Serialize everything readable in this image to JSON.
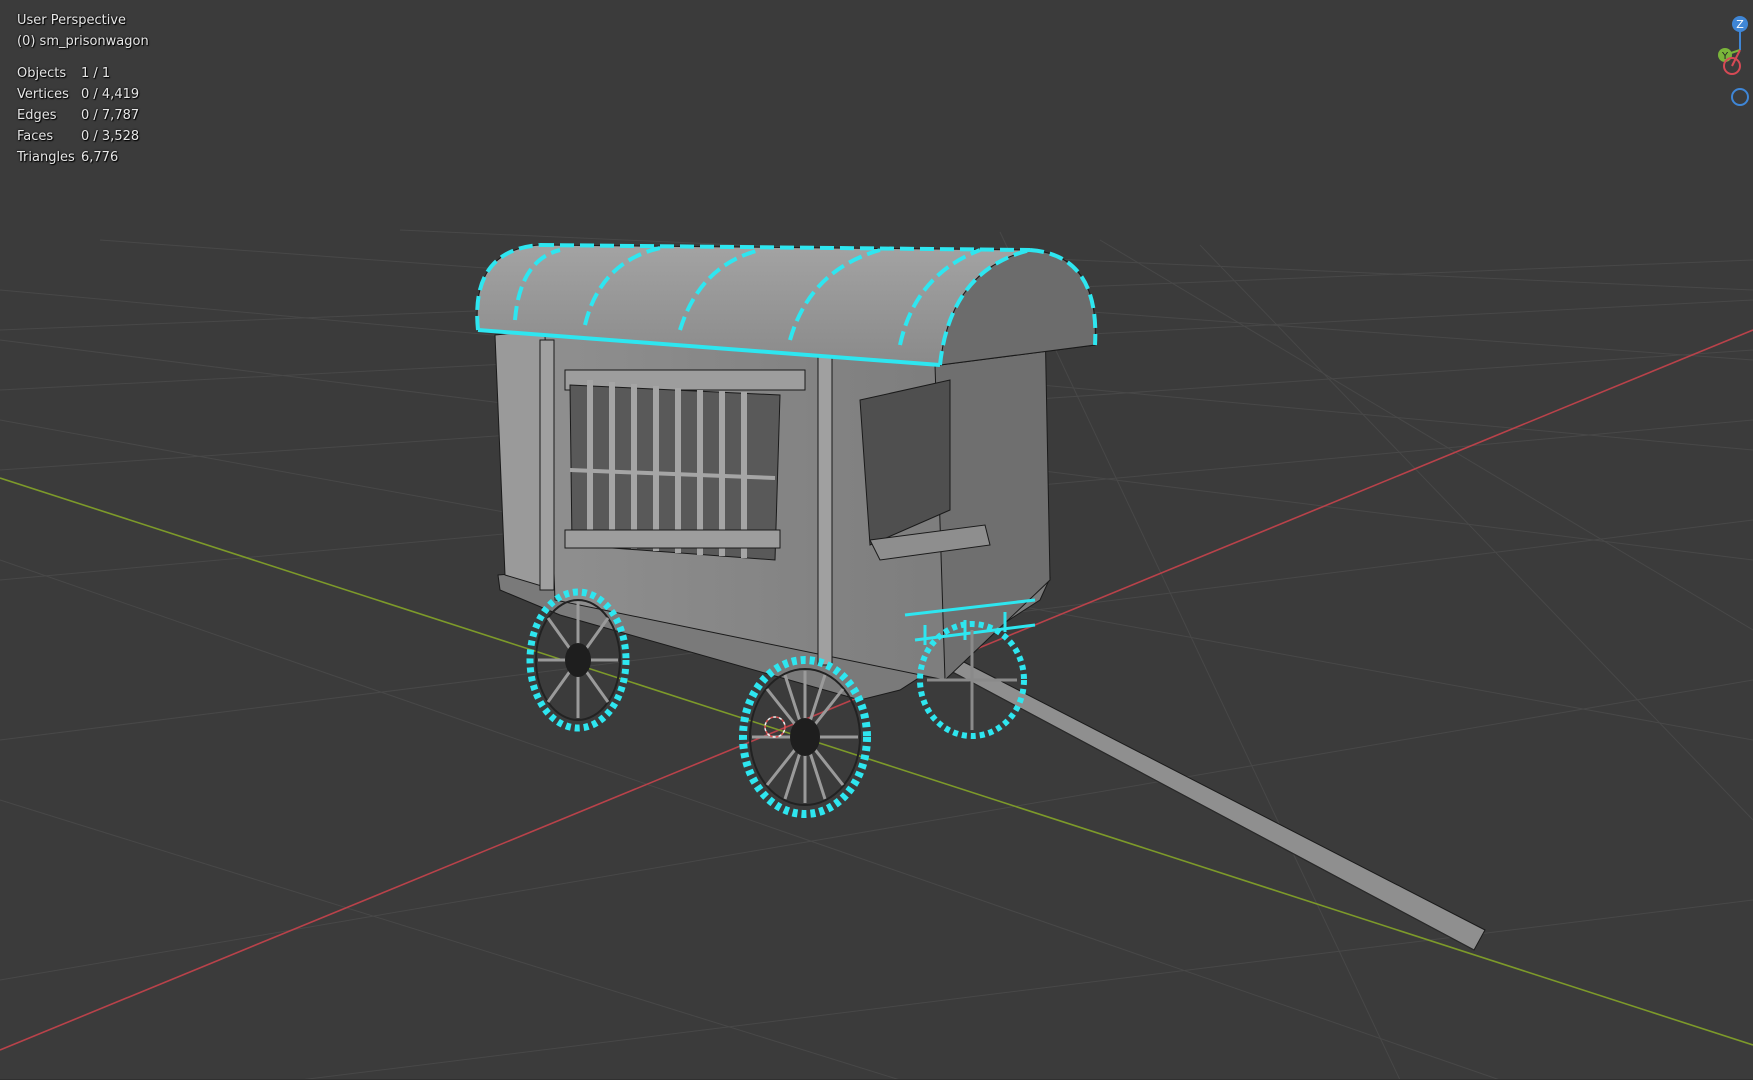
{
  "viewport": {
    "view_name": "User Perspective",
    "object_name": "(0) sm_prisonwagon"
  },
  "stats": [
    {
      "label": "Objects",
      "value": "1 / 1"
    },
    {
      "label": "Vertices",
      "value": "0 / 4,419"
    },
    {
      "label": "Edges",
      "value": "0 / 7,787"
    },
    {
      "label": "Faces",
      "value": "0 / 3,528"
    },
    {
      "label": "Triangles",
      "value": "6,776"
    }
  ],
  "gizmo": {
    "z_label": "Z",
    "y_label": "Y",
    "x_color": "#d64a55",
    "y_color": "#7ab53a",
    "z_color": "#3f86d6"
  },
  "colors": {
    "background": "#3b3b3b",
    "grid": "#484848",
    "x_axis": "#b9424a",
    "y_axis": "#7d9a2a",
    "mesh_face": "#8c8c8c",
    "seam_highlight": "#2ee6f0",
    "vertex": "#111111"
  },
  "icons": [
    "origin-icon",
    "navigation-gizmo-icon"
  ]
}
